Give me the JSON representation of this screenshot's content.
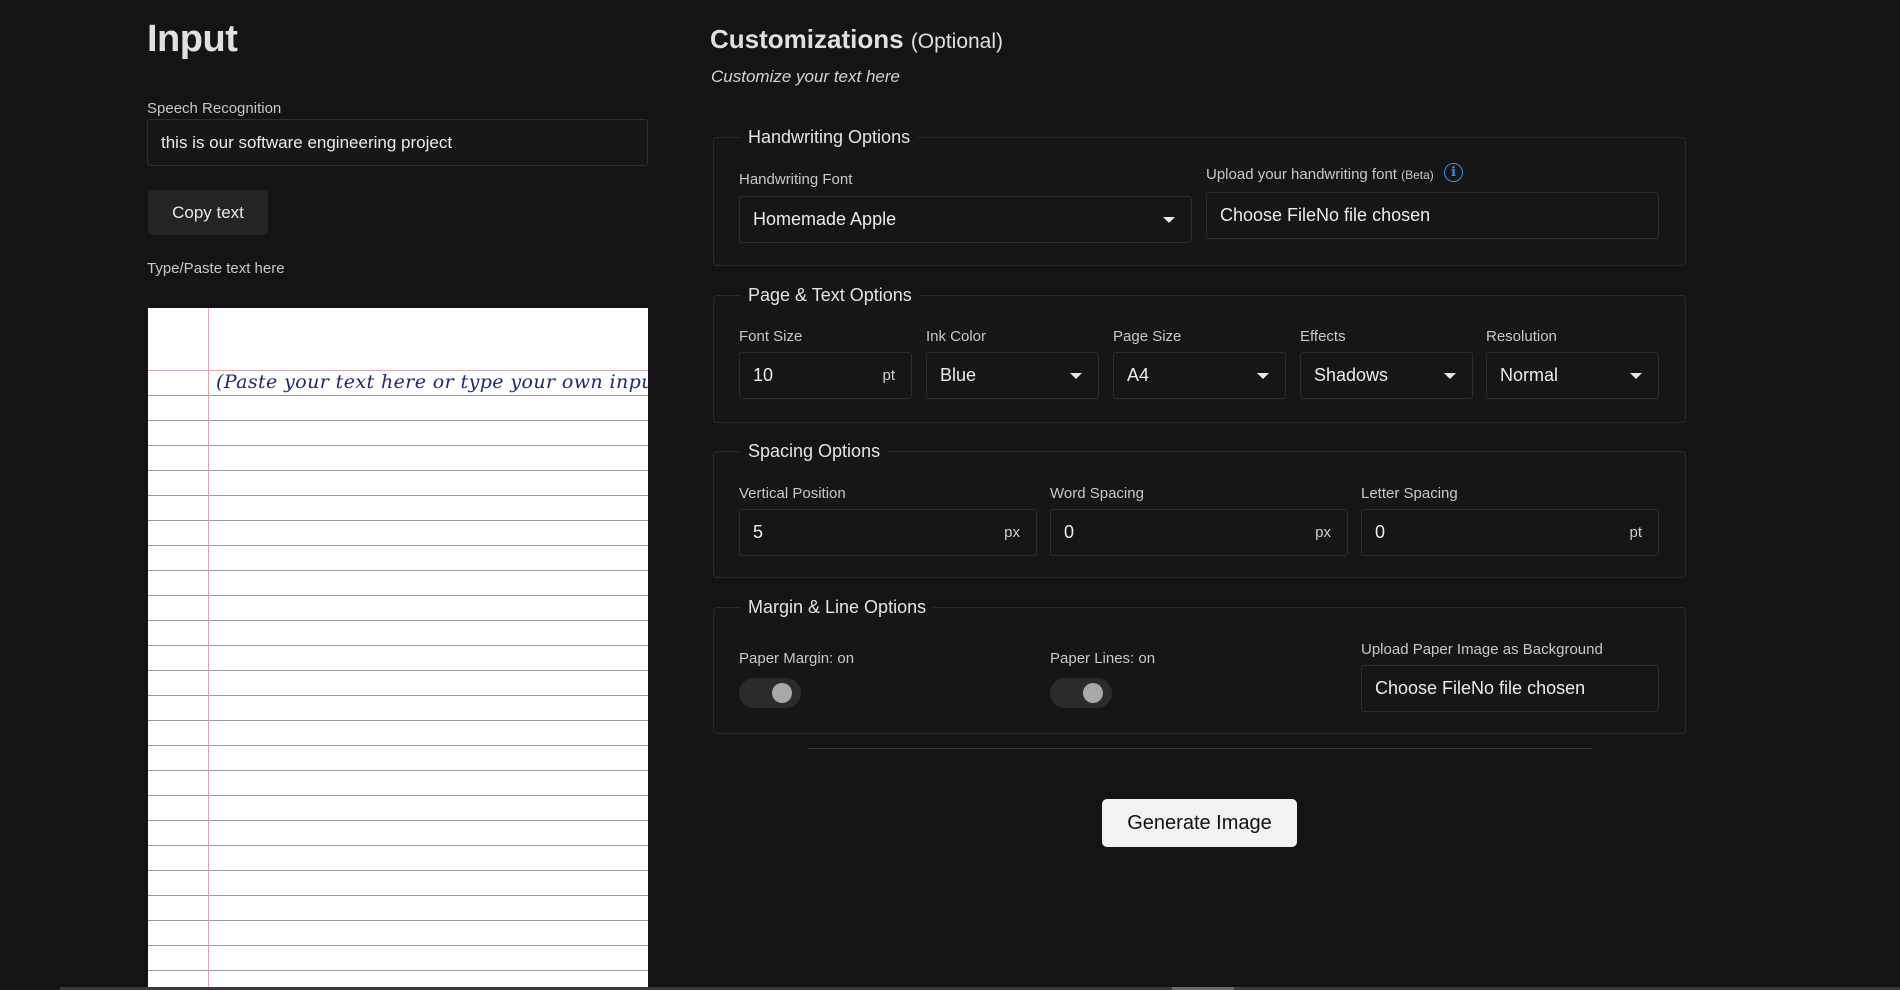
{
  "input": {
    "title": "Input",
    "speech_label": "Speech Recognition",
    "speech_value": "this is our software engineering project",
    "copy_button": "Copy text",
    "type_label": "Type/Paste text here",
    "paper_placeholder": "(Paste your text here or type your own input)."
  },
  "customizations": {
    "title": "Customizations",
    "title_optional": "(Optional)",
    "subtitle": "Customize your text here"
  },
  "handwriting": {
    "legend": "Handwriting Options",
    "font_label": "Handwriting Font",
    "font_value": "Homemade Apple",
    "upload_label": "Upload your handwriting font",
    "upload_beta": "(Beta)",
    "upload_value": "Choose FileNo file chosen",
    "info_icon": "info-icon"
  },
  "page_text": {
    "legend": "Page & Text Options",
    "font_size_label": "Font Size",
    "font_size_value": "10",
    "font_size_unit": "pt",
    "ink_label": "Ink Color",
    "ink_value": "Blue",
    "page_size_label": "Page Size",
    "page_size_value": "A4",
    "effects_label": "Effects",
    "effects_value": "Shadows",
    "resolution_label": "Resolution",
    "resolution_value": "Normal"
  },
  "spacing": {
    "legend": "Spacing Options",
    "vertical_label": "Vertical Position",
    "vertical_value": "5",
    "vertical_unit": "px",
    "word_label": "Word Spacing",
    "word_value": "0",
    "word_unit": "px",
    "letter_label": "Letter Spacing",
    "letter_value": "0",
    "letter_unit": "pt"
  },
  "margin_line": {
    "legend": "Margin & Line Options",
    "margin_label": "Paper Margin: on",
    "lines_label": "Paper Lines: on",
    "bg_label": "Upload Paper Image as Background",
    "bg_value": "Choose FileNo file chosen"
  },
  "generate_button": "Generate Image",
  "colors": {
    "background": "#141414",
    "ink": "#1e2a6e",
    "margin_line": "#e3a5ad",
    "info_accent": "#3b8ee8",
    "generate_button_bg": "#f2f2f2"
  }
}
